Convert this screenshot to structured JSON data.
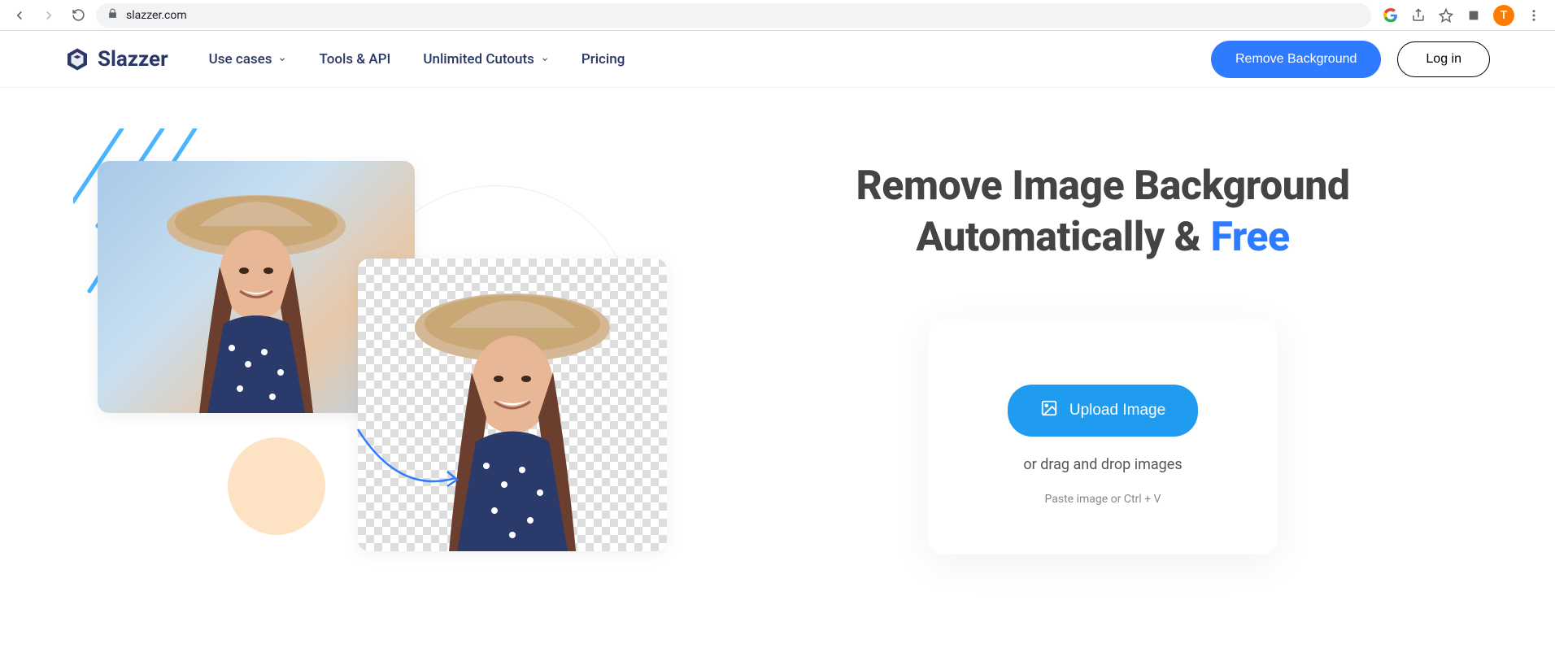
{
  "browser": {
    "url": "slazzer.com",
    "avatar_initial": "T"
  },
  "header": {
    "brand": "Slazzer",
    "nav": {
      "use_cases": "Use cases",
      "tools_api": "Tools & API",
      "unlimited_cutouts": "Unlimited Cutouts",
      "pricing": "Pricing"
    },
    "cta_primary": "Remove Background",
    "cta_login": "Log in"
  },
  "hero": {
    "title_line1": "Remove Image Background",
    "title_line2a": "Automatically & ",
    "title_line2b": "Free",
    "upload_button": "Upload Image",
    "drag_text": "or drag and drop images",
    "paste_text": "Paste image or Ctrl + V"
  },
  "colors": {
    "brand_navy": "#2a3869",
    "accent_blue": "#2f7bff",
    "upload_blue": "#1f9cf0"
  }
}
